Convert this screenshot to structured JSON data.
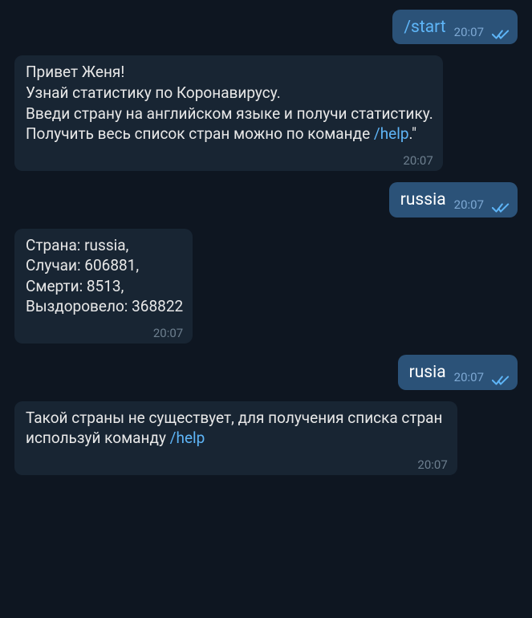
{
  "messages": {
    "m0": {
      "text": "/start",
      "time": "20:07",
      "command": true
    },
    "m1": {
      "l1": "Привет Женя!",
      "l2": "Узнай статистику по Коронавирусу.",
      "l3": "Введи страну на английском языке и получи статистику.",
      "l4_pre": "Получить весь список стран можно по команде ",
      "l4_link": "/help",
      "l4_post": ".\"",
      "time": "20:07"
    },
    "m2": {
      "text": "russia",
      "time": "20:07"
    },
    "m3": {
      "l1": "Страна: russia,",
      "l2": "Случаи: 606881,",
      "l3": "Смерти: 8513,",
      "l4": "Выздоровело: 368822",
      "time": "20:07"
    },
    "m4": {
      "text": "rusia",
      "time": "20:07"
    },
    "m5": {
      "pre": "Такой страны не существует, для получения списка стран используй команду ",
      "link": "/help",
      "time": "20:07"
    }
  },
  "colors": {
    "bg": "#0e1621",
    "in": "#182533",
    "out": "#2b5278",
    "link": "#5eb5f7",
    "tick": "#5eb5f7"
  }
}
